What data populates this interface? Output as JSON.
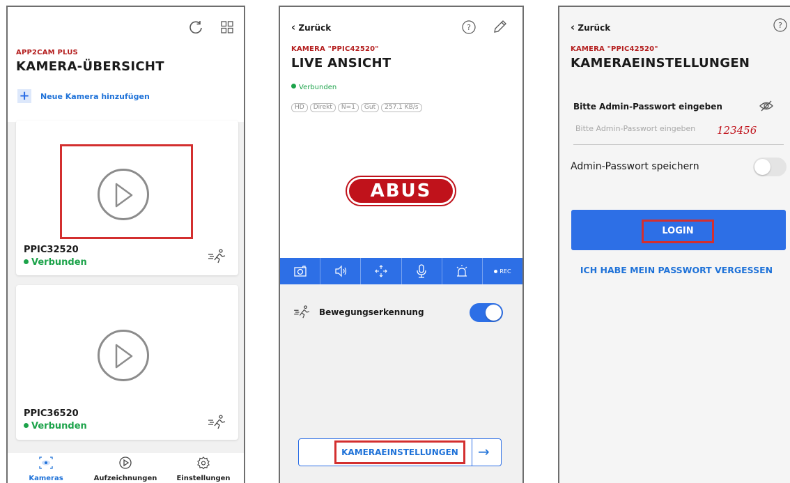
{
  "screen1": {
    "brand": "APP2CAM PLUS",
    "title": "KAMERA-ÜBERSICHT",
    "add_camera": "Neue Kamera hinzufügen",
    "refresh_icon": "refresh-icon",
    "grid_icon": "grid-view-icon",
    "cameras": [
      {
        "name": "PPIC32520",
        "status": "Verbunden"
      },
      {
        "name": "PPIC36520",
        "status": "Verbunden"
      }
    ],
    "tabs": [
      {
        "label": "Kameras",
        "icon": "camera-eye-icon",
        "active": true
      },
      {
        "label": "Aufzeichnungen",
        "icon": "play-circle-icon",
        "active": false
      },
      {
        "label": "Einstellungen",
        "icon": "gear-icon",
        "active": false
      }
    ]
  },
  "screen2": {
    "back_label": "Zurück",
    "eyebrow": "KAMERA \"PPIC42520\"",
    "title": "LIVE ANSICHT",
    "status": "Verbunden",
    "chips": [
      "HD",
      "Direkt",
      "N=1",
      "Gut",
      "257.1 KB/s"
    ],
    "logo_text": "ABUS",
    "toolbar": [
      {
        "icon": "snapshot-icon"
      },
      {
        "icon": "speaker-icon"
      },
      {
        "icon": "ptz-move-icon"
      },
      {
        "icon": "microphone-icon"
      },
      {
        "icon": "alarm-siren-icon"
      },
      {
        "icon": "record-icon",
        "label": "REC"
      }
    ],
    "motion_label": "Bewegungserkennung",
    "motion_enabled": true,
    "settings_button": "KAMERAEINSTELLUNGEN"
  },
  "screen3": {
    "back_label": "Zurück",
    "eyebrow": "KAMERA \"PPIC42520\"",
    "title": "KAMERAEINSTELLUNGEN",
    "password_label": "Bitte Admin-Passwort eingeben",
    "password_placeholder": "Bitte Admin-Passwort eingeben",
    "password_hint": "123456",
    "save_password_label": "Admin-Passwort speichern",
    "save_password_enabled": false,
    "login_button": "LOGIN",
    "forgot_password": "ICH HABE MEIN PASSWORT VERGESSEN"
  },
  "colors": {
    "brand_red": "#b41e1e",
    "accent_blue": "#2d6fe6",
    "status_green": "#1ca34a",
    "highlight_red": "#d32f2f"
  }
}
